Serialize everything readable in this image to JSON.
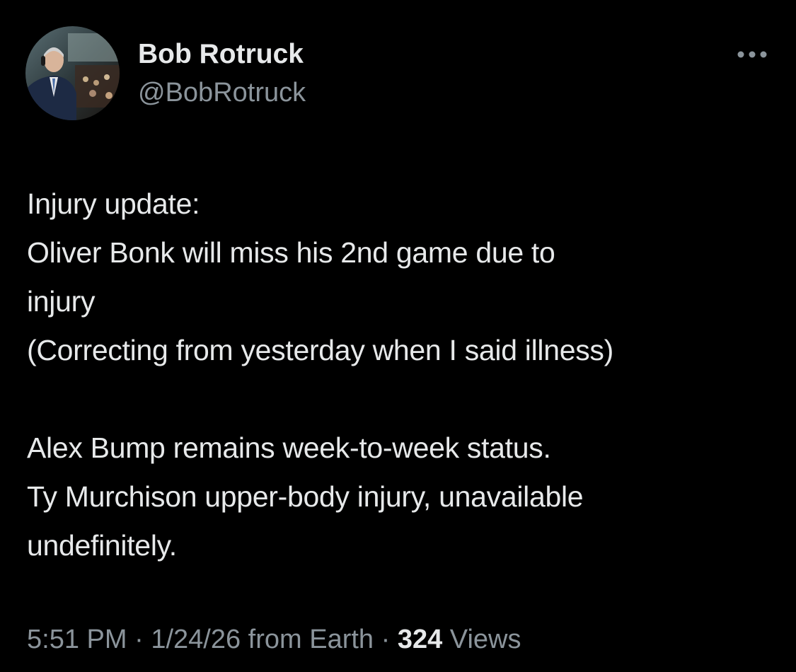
{
  "colors": {
    "background": "#000000",
    "primary_text": "#e7e9ea",
    "secondary_text": "#8b949b"
  },
  "author": {
    "display_name": "Bob Rotruck",
    "handle": "@BobRotruck"
  },
  "more_icon": "more-horizontal-icon",
  "tweet": {
    "lines": [
      "Injury update:",
      "Oliver Bonk will miss his 2nd game due to",
      "injury",
      "(Correcting from yesterday when I said illness)",
      "",
      "Alex Bump remains week-to-week status.",
      "Ty Murchison upper-body injury, unavailable",
      "undefinitely."
    ]
  },
  "meta": {
    "time": "5:51 PM",
    "separator_1": " · ",
    "date": "1/24/26",
    "location": " from Earth",
    "separator_2": " · ",
    "views_count": "324",
    "views_label": " Views"
  }
}
